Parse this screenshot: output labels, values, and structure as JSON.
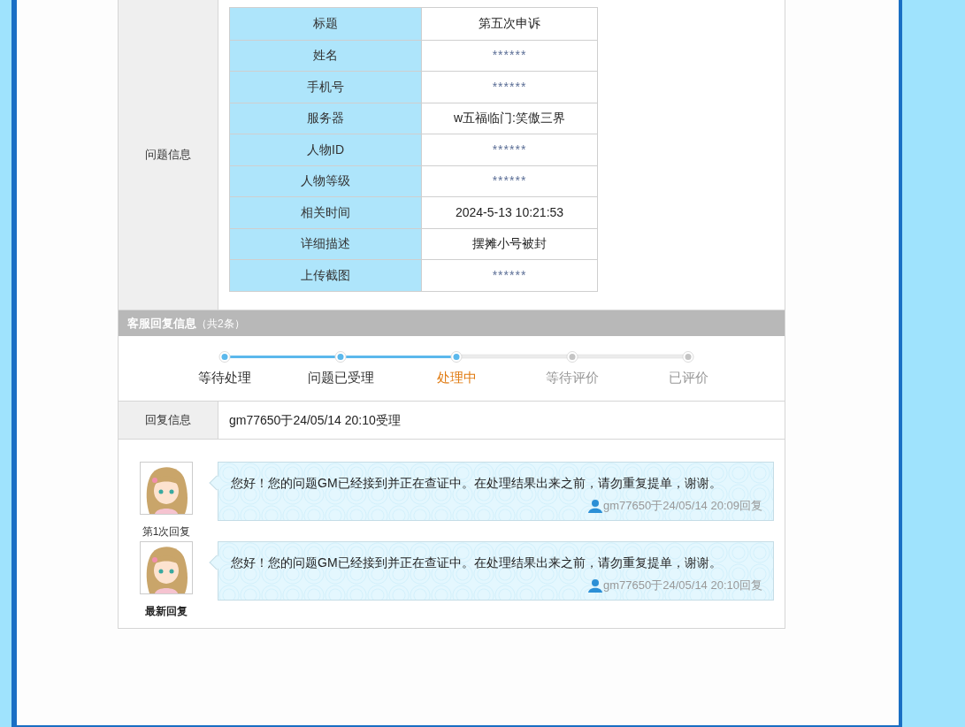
{
  "issue_info": {
    "label": "问题信息",
    "rows": [
      {
        "field": "标题",
        "value": "第五次申诉",
        "masked": false
      },
      {
        "field": "姓名",
        "value": "******",
        "masked": true
      },
      {
        "field": "手机号",
        "value": "******",
        "masked": true
      },
      {
        "field": "服务器",
        "value": "w五福临门:笑傲三界",
        "masked": false
      },
      {
        "field": "人物ID",
        "value": "******",
        "masked": true
      },
      {
        "field": "人物等级",
        "value": "******",
        "masked": true
      },
      {
        "field": "相关时间",
        "value": "2024-5-13 10:21:53",
        "masked": false
      },
      {
        "field": "详细描述",
        "value": "摆摊小号被封",
        "masked": false
      },
      {
        "field": "上传截图",
        "value": "******",
        "masked": true
      }
    ]
  },
  "replies_header": {
    "title": "客服回复信息",
    "count": "（共2条）"
  },
  "progress": [
    {
      "label": "等待处理",
      "reached": true,
      "current": false
    },
    {
      "label": "问题已受理",
      "reached": true,
      "current": false
    },
    {
      "label": "处理中",
      "reached": true,
      "current": true
    },
    {
      "label": "等待评价",
      "reached": false,
      "current": false
    },
    {
      "label": "已评价",
      "reached": false,
      "current": false
    }
  ],
  "reply_info": {
    "label": "回复信息",
    "value": "gm77650于24/05/14 20:10受理"
  },
  "replies": [
    {
      "caption": "第1次回复",
      "latest": false,
      "message": "您好！您的问题GM已经接到并正在查证中。在处理结果出来之前，请勿重复提单，谢谢。",
      "meta": "gm77650于24/05/14 20:09回复"
    },
    {
      "caption": "最新回复",
      "latest": true,
      "message": "您好！您的问题GM已经接到并正在查证中。在处理结果出来之前，请勿重复提单，谢谢。",
      "meta": "gm77650于24/05/14 20:10回复"
    }
  ]
}
